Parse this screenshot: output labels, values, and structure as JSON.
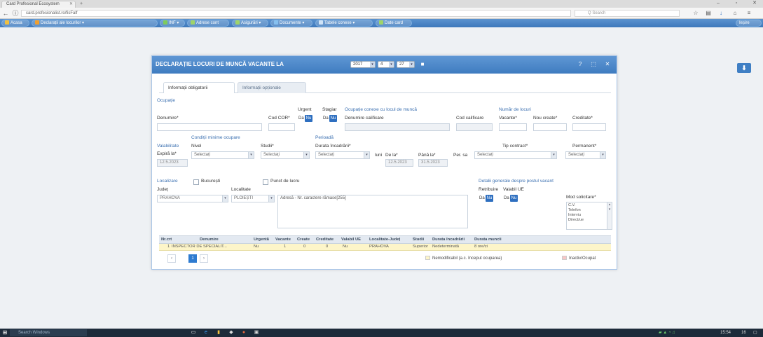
{
  "browser": {
    "tab_title": "Card Profesional Ecosystem",
    "url": "card.profesionalist.ro/fisFalf",
    "search_placeholder": "Q Search"
  },
  "app_menu": [
    {
      "label": "Acasa",
      "color": "#f0c040"
    },
    {
      "label": "Declarații ale locurilor",
      "color": "#f0a030"
    },
    {
      "label": "INF",
      "color": "#7ecb5c"
    },
    {
      "label": "Adrese cont",
      "color": "#9fd46a"
    },
    {
      "label": "Asigurări",
      "color": "#9fd46a"
    },
    {
      "label": "Documente",
      "color": "#86c0ef"
    },
    {
      "label": "Tabele conexe",
      "color": "#cfe3f7"
    },
    {
      "label": "Date card",
      "color": "#9fd46a"
    }
  ],
  "app_menu_right": "Ieșire",
  "dialog": {
    "title": "DECLARAȚIE LOCURI DE MUNCĂ VACANTE LA",
    "header_values": [
      "2017",
      "4",
      "27"
    ],
    "tabs": [
      "Informații obligatorii",
      "Informații opționale"
    ],
    "ocupatie": {
      "section": "Ocupație",
      "denumire_label": "Denumire*",
      "cod_cor_label": "Cod COR*",
      "urgent_label": "Urgent",
      "stagiar_label": "Stagiar",
      "da": "Da",
      "nu": "Nu"
    },
    "ocupatie_calificare": {
      "section": "Ocupație conexe cu locul de muncă",
      "denumire_calificare_label": "Denumire calificare",
      "cod_calificare_label": "Cod calificare"
    },
    "numar_locuri": {
      "section": "Număr de locuri",
      "vacante_label": "Vacante*",
      "nou_create_label": "Nou create*",
      "creditate_label": "Creditate*"
    },
    "valabilitate": {
      "section": "Valabilitate",
      "expira_label": "Expiră la*",
      "expira_value": "12.5.2023"
    },
    "conditii": {
      "section": "Condiții minime ocupare",
      "studii_label": "Nivel",
      "studii_value": "Selectați",
      "studii2_label": "Studii*",
      "studii2_value": "Selectați"
    },
    "perioada": {
      "section": "Perioadă",
      "durata_label": "Durata încadrării*",
      "durata_value": "Selectați",
      "luni_label": "luni",
      "de_la_label": "De la*",
      "de_la_value": "12.5.2023",
      "pana_la_label": "Până la*",
      "pana_la_value": "31.5.2023",
      "per_label": "Per. sa",
      "tip_contract_label": "Tip contract*",
      "tip_contract_value": "Selectați",
      "permanent_label": "Permanent*",
      "permanent_value": "Selectați"
    },
    "localizare": {
      "section": "Localizare",
      "bucuresti_label": "București",
      "punct_lucru_label": "Punct de lucru",
      "judet_label": "Județ",
      "judet_value": "PRAHOVA",
      "localitate_label": "Localitate",
      "localitate_value": "PLOIEȘTI",
      "adresa_value": "Adresă - Nr. caractere rămase[255]"
    },
    "detalii_generale": {
      "section": "Detalii generale despre postul vacant",
      "retribuire_label": "Retribuire",
      "valabil_ue_label": "Valabil UE",
      "mod_solicitare_label": "Mod solicitare*",
      "mod_options": [
        "C.V.",
        "Telefon",
        "Interviu",
        "Direct/ue"
      ]
    },
    "grid": {
      "headers": [
        "Nr.crt",
        "Denumire",
        "Urgentă",
        "Vacante",
        "Create",
        "Creditate",
        "Valabil UE",
        "Localitate-Județ",
        "Studii",
        "Durata încadrării",
        "Durata muncii"
      ],
      "rows": [
        [
          "1",
          "INSPECTOR DE SPECIALIT...",
          "Nu",
          "1",
          "0",
          "0",
          "Nu",
          "PRAHOVA",
          "Superior",
          "Nedeterminată",
          "8 ore/zi"
        ]
      ]
    },
    "pager": {
      "prev": "‹",
      "current": "1",
      "next": "›",
      "first": "«"
    },
    "legend": {
      "modified": "Nemodificabil (a.c. început ocuparea)",
      "modified_color": "#fdf5c9",
      "inactive": "Inactiv/Ocupat",
      "inactive_color": "#f7c6c6"
    }
  },
  "taskbar": {
    "search_placeholder": "Search Windows",
    "time": "15:54",
    "date": "16"
  }
}
